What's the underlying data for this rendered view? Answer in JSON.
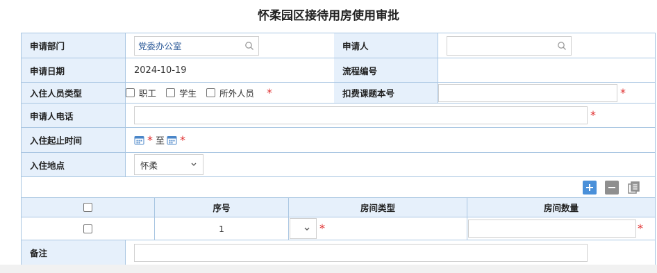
{
  "title": "怀柔园区接待用房使用审批",
  "fields": {
    "dept_label": "申请部门",
    "dept_value": "党委办公室",
    "applicant_label": "申请人",
    "applicant_value": "",
    "date_label": "申请日期",
    "date_value": "2024-10-19",
    "flow_label": "流程编号",
    "flow_value": "",
    "guest_type_label": "入住人员类型",
    "guest_types": [
      "职工",
      "学生",
      "所外人员"
    ],
    "fee_label": "扣费课题本号",
    "phone_label": "申请人电话",
    "period_label": "入住起止时间",
    "period_to": "至",
    "location_label": "入住地点",
    "location_value": "怀柔",
    "remark_label": "备注"
  },
  "required_mark": "*",
  "grid": {
    "headers": [
      "序号",
      "房间类型",
      "房间数量"
    ],
    "rows": [
      {
        "index": "1",
        "room_type": "",
        "room_count": ""
      }
    ]
  },
  "toolbar": {
    "add_icon": "plus-icon",
    "remove_icon": "minus-icon",
    "copy_icon": "copy-icon"
  },
  "colors": {
    "label_bg": "#e6f0fb",
    "border": "#a9c6e2",
    "required": "#e03030",
    "add_button": "#4a90d9"
  }
}
